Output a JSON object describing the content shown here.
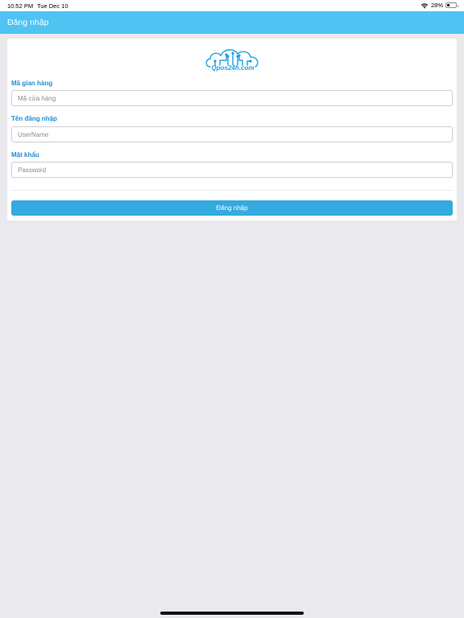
{
  "status_bar": {
    "time": "10:52 PM",
    "date": "Tue Dec 10",
    "battery_percent": "28%",
    "battery_level": 0.28,
    "wifi_icon": "wifi-icon"
  },
  "nav": {
    "title": "Đăng nhập",
    "color": "#4fc3f2"
  },
  "logo": {
    "text": "Qpos24h.com",
    "icon": "cloud-network-logo",
    "color": "#1f9fe0"
  },
  "form": {
    "store_code": {
      "label": "Mã gian hàng",
      "placeholder": "Mã cửa hàng",
      "value": ""
    },
    "username": {
      "label": "Tên đăng nhập",
      "placeholder": "UserName",
      "value": ""
    },
    "password": {
      "label": "Mật khẩu",
      "placeholder": "Password",
      "value": ""
    },
    "submit_label": "Đăng nhập",
    "label_color": "#1f8dd6",
    "button_color": "#34aadf"
  }
}
